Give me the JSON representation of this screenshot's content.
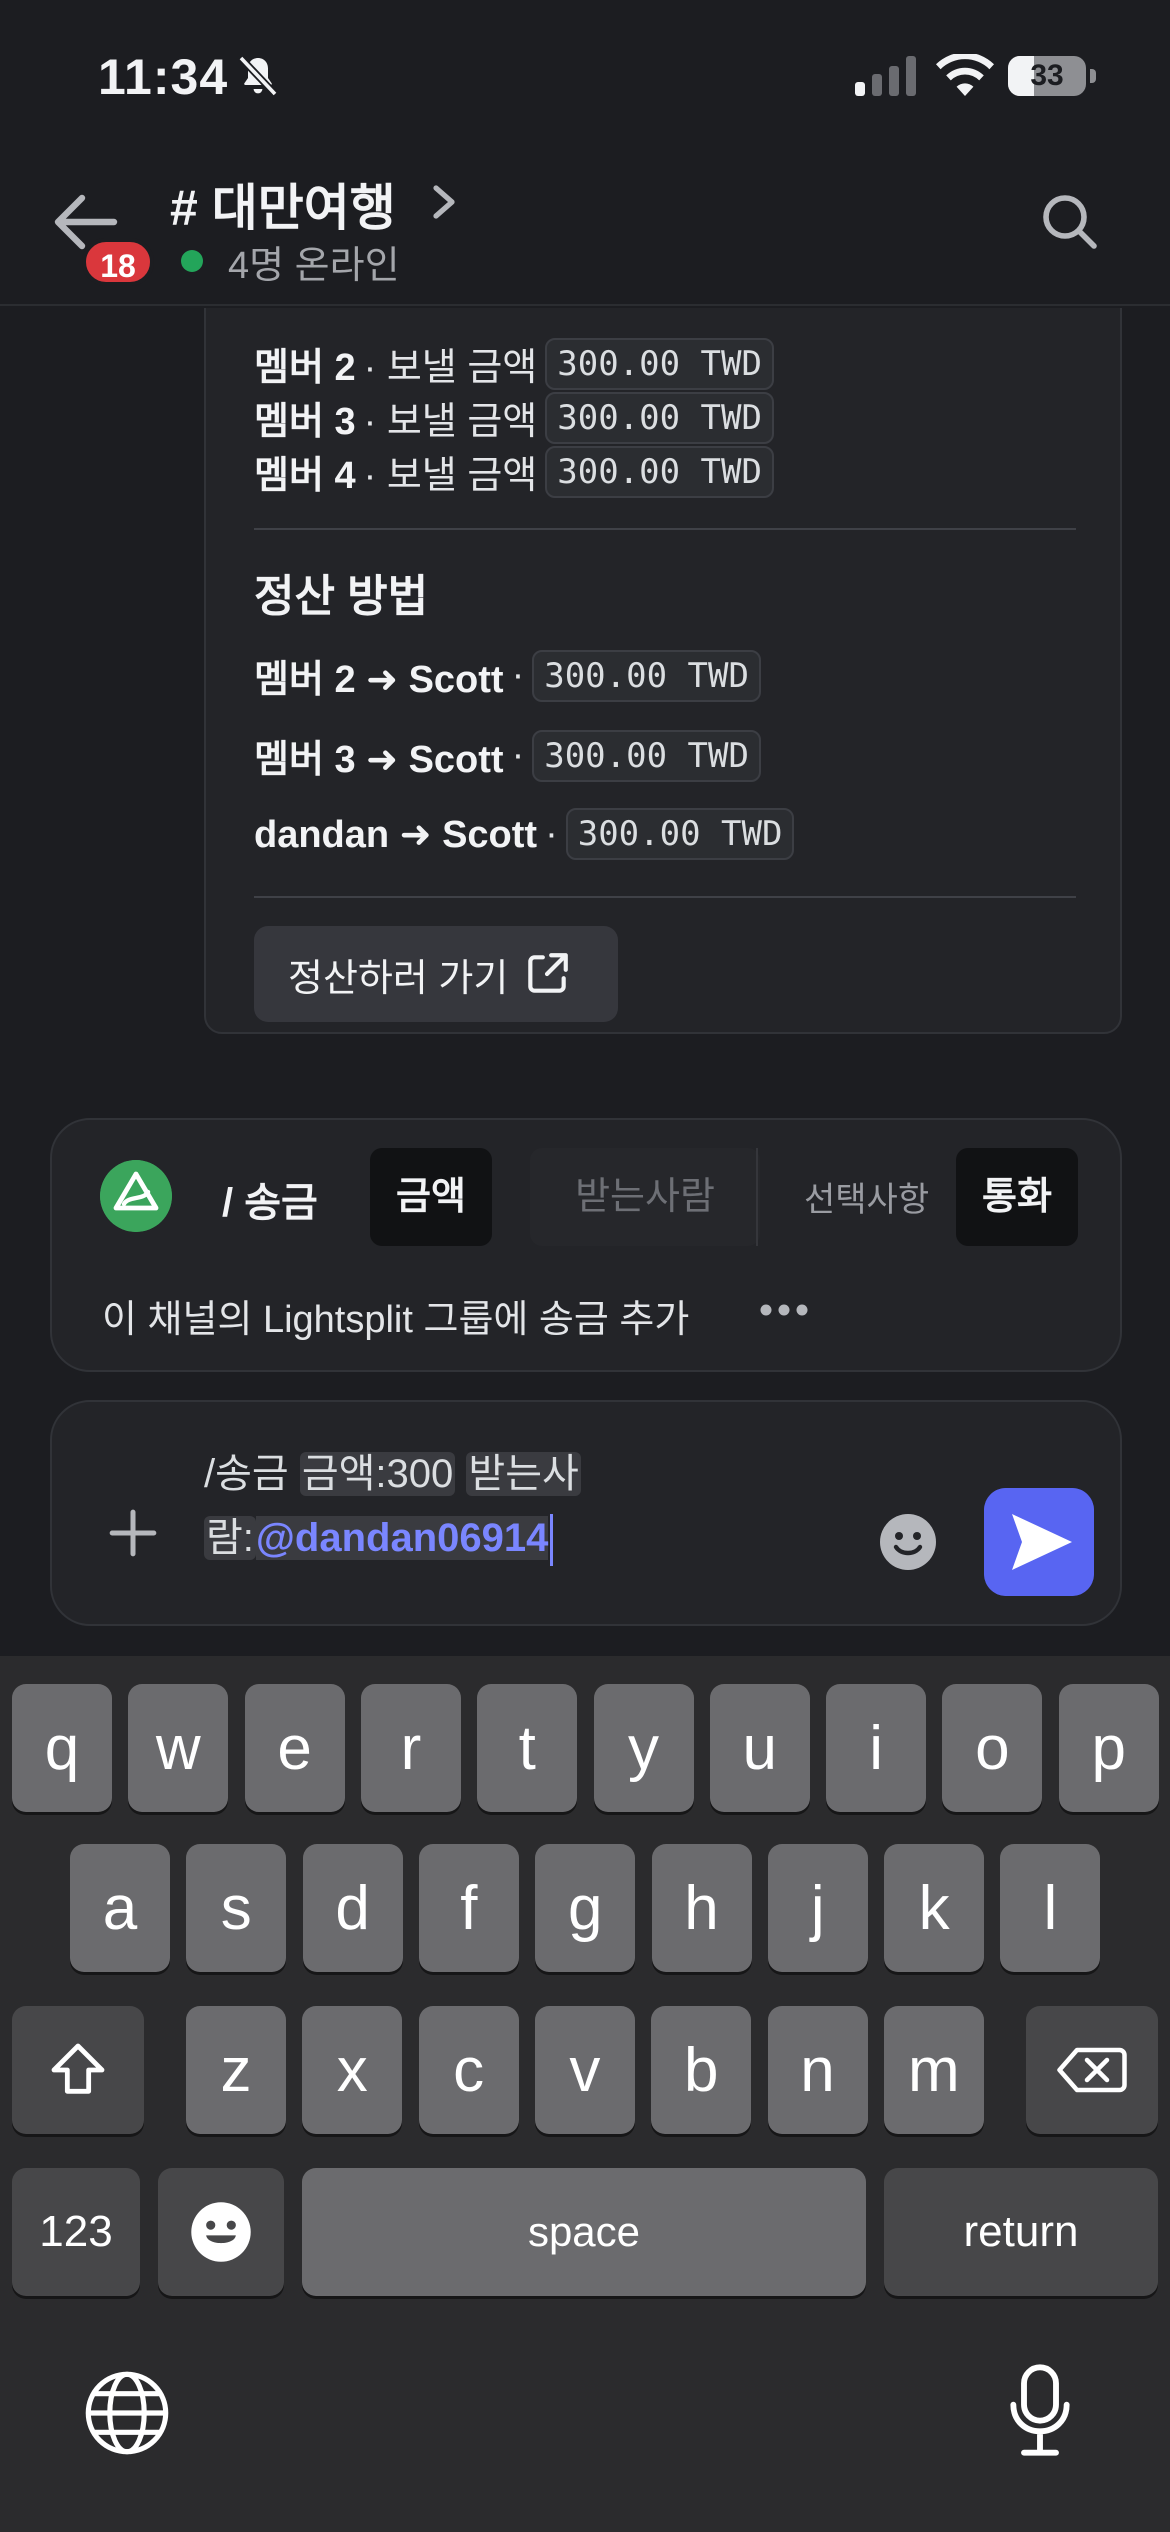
{
  "status_bar": {
    "time": "11:34",
    "battery": "33",
    "battery_level": 0.33
  },
  "header": {
    "unread_count": "18",
    "channel_title": "# 대만여행",
    "online_text": "4명 온라인"
  },
  "embed": {
    "send_rows": [
      {
        "member": "멤버 2",
        "label": "· 보낼 금액",
        "amount": "300.00 TWD"
      },
      {
        "member": "멤버 3",
        "label": "· 보낼 금액",
        "amount": "300.00 TWD"
      },
      {
        "member": "멤버 4",
        "label": "· 보낼 금액",
        "amount": "300.00 TWD"
      }
    ],
    "settle_title": "정산 방법",
    "settle_rows": [
      {
        "pair": "멤버 2 ➜ Scott",
        "sep": "·",
        "amount": "300.00 TWD"
      },
      {
        "pair": "멤버 3 ➜ Scott",
        "sep": "·",
        "amount": "300.00 TWD"
      },
      {
        "pair": "dandan ➜ Scott",
        "sep": "·",
        "amount": "300.00 TWD"
      }
    ],
    "settle_button": "정산하러 가기"
  },
  "command": {
    "name": "/ 송금",
    "options": {
      "amount": "금액",
      "receiver": "받는사람",
      "optional_label": "선택사항",
      "currency": "통화"
    },
    "description": "이 채널의 Lightsplit 그룹에 송금 추가"
  },
  "composer": {
    "prefix": "/송금 ",
    "amount_param": "금액:300",
    "receiver_param_1": "받는사",
    "receiver_param_2": "람:",
    "mention": "@dandan06914"
  },
  "keyboard": {
    "row1": [
      "q",
      "w",
      "e",
      "r",
      "t",
      "y",
      "u",
      "i",
      "o",
      "p"
    ],
    "row2": [
      "a",
      "s",
      "d",
      "f",
      "g",
      "h",
      "j",
      "k",
      "l"
    ],
    "row3": [
      "z",
      "x",
      "c",
      "v",
      "b",
      "n",
      "m"
    ],
    "numbers_key": "123",
    "space_key": "space",
    "return_key": "return"
  },
  "colors": {
    "accent": "#5865f2",
    "online": "#23a55a",
    "badge": "#da373c",
    "mention": "#7a86ff"
  }
}
